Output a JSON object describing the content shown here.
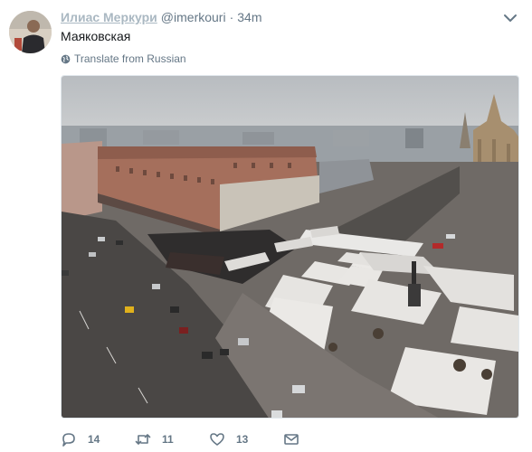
{
  "author": {
    "display_name": "Илиас Меркури",
    "handle": "@imerkouri",
    "separator": "·",
    "time": "34m"
  },
  "tweet": {
    "text": "Маяковская",
    "translate_label": "Translate from Russian"
  },
  "stats": {
    "replies": "14",
    "retweets": "11",
    "likes": "13"
  },
  "icons": {
    "caret": "chevron-down-icon",
    "translate": "globe-icon",
    "reply": "reply-icon",
    "retweet": "retweet-icon",
    "like": "heart-icon",
    "dm": "envelope-icon"
  },
  "colors": {
    "text": "#14171a",
    "secondary": "#657786",
    "name": "#aab8c2"
  }
}
